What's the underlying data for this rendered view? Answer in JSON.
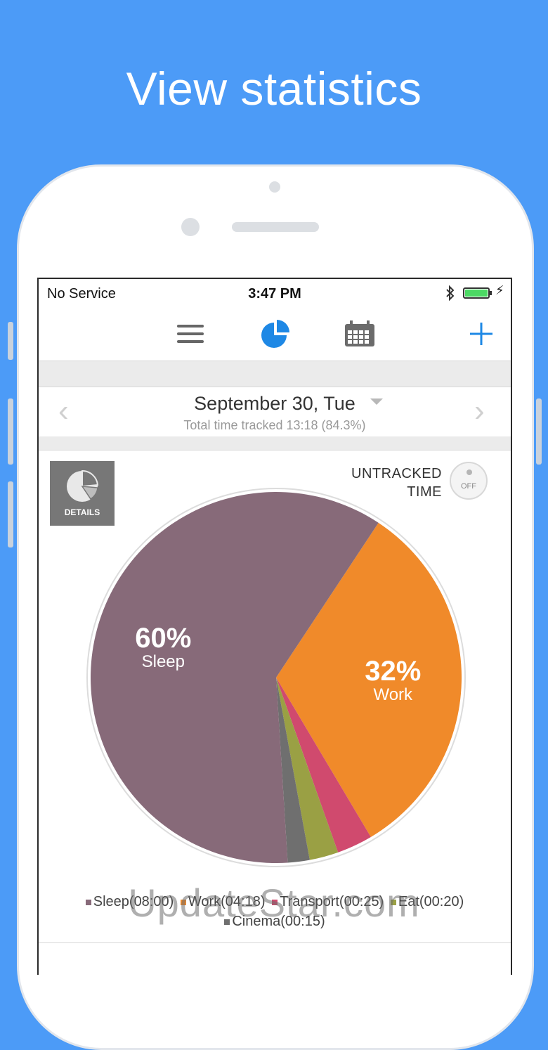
{
  "headline": "View statistics",
  "status": {
    "carrier": "No Service",
    "time": "3:47 PM"
  },
  "toolbar": {
    "menu_icon": "hamburger-icon",
    "stats_icon": "pie-chart-icon",
    "calendar_icon": "calendar-icon",
    "add_icon": "plus-icon",
    "accent": "#1e88e5"
  },
  "date_bar": {
    "title": "September 30, Tue",
    "subtitle": "Total time tracked 13:18 (84.3%)",
    "prev": "‹",
    "next": "›"
  },
  "details_button": {
    "label": "DETAILS"
  },
  "untracked": {
    "line1": "UNTRACKED",
    "line2": "TIME",
    "toggle_label": "OFF"
  },
  "chart_data": {
    "type": "pie",
    "slices": [
      {
        "name": "Sleep",
        "label": "Sleep(08:00)",
        "percent_label": "60%",
        "value": 60,
        "color": "#876a79"
      },
      {
        "name": "Work",
        "label": "Work(04:18)",
        "percent_label": "32%",
        "value": 32,
        "color": "#f08a2a"
      },
      {
        "name": "Transport",
        "label": "Transport(00:25)",
        "value": 3.1,
        "color": "#d04a6e"
      },
      {
        "name": "Eat",
        "label": "Eat(00:20)",
        "value": 2.5,
        "color": "#9aa044"
      },
      {
        "name": "Cinema",
        "label": "Cinema(00:15)",
        "value": 1.9,
        "color": "#6f6f6f"
      }
    ],
    "legend_placement": "bottom"
  },
  "watermark": "UpdateStar.com"
}
